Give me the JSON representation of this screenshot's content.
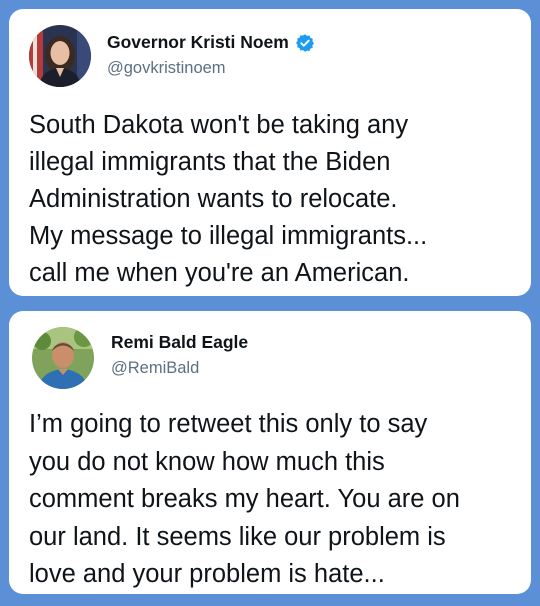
{
  "tweets": [
    {
      "display_name": "Governor Kristi Noem",
      "handle": "@govkristinoem",
      "verified": true,
      "avatar": "profile-photo-woman",
      "text_lines": [
        "South Dakota won't be taking any",
        "illegal immigrants that the Biden",
        "Administration wants to relocate.",
        "My message to illegal immigrants...",
        "call me when you're an American."
      ]
    },
    {
      "display_name": "Remi Bald Eagle",
      "handle": "@RemiBald",
      "verified": false,
      "avatar": "profile-photo-man",
      "text_lines": [
        "I’m going to retweet this only to say",
        "you do not know how much this",
        "comment breaks my heart. You are on",
        "our land. It seems like our problem is",
        "love and your problem is hate..."
      ]
    }
  ],
  "colors": {
    "background": "#5b8fd6",
    "card": "#ffffff",
    "verified_badge": "#1d9bf0",
    "handle_text": "#5b7083",
    "body_text": "#0f1419"
  }
}
